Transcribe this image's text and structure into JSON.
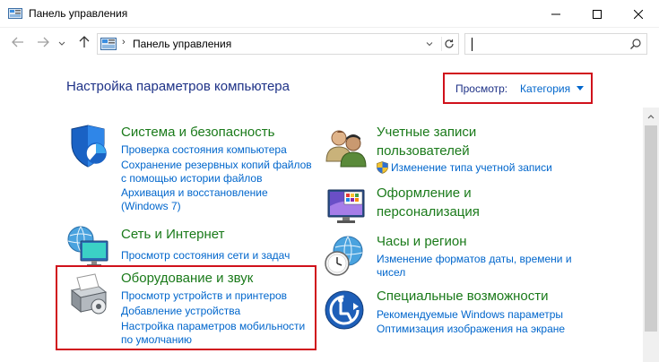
{
  "window": {
    "title": "Панель управления",
    "minimize_icon": "minimize-icon",
    "maximize_icon": "maximize-icon",
    "close_icon": "close-icon"
  },
  "address_bar": {
    "separator": "›",
    "path": "Панель управления",
    "search_placeholder": ""
  },
  "header": {
    "title": "Настройка параметров компьютера",
    "view_label": "Просмотр:",
    "view_value": "Категория"
  },
  "categories": {
    "system": {
      "title": "Система и безопасность",
      "links": [
        "Проверка состояния компьютера",
        "Сохранение резервных копий файлов",
        "с помощью истории файлов",
        "Архивация и восстановление",
        "(Windows 7)"
      ]
    },
    "network": {
      "title": "Сеть и Интернет",
      "links": [
        "Просмотр состояния сети и задач"
      ]
    },
    "hardware": {
      "title": "Оборудование и звук",
      "links": [
        "Просмотр устройств и принтеров",
        "Добавление устройства",
        "Настройка параметров мобильности",
        "по умолчанию"
      ]
    },
    "accounts": {
      "title_line1": "Учетные записи",
      "title_line2": "пользователей",
      "links": [
        "Изменение типа учетной записи"
      ]
    },
    "appearance": {
      "title_line1": "Оформление и",
      "title_line2": "персонализация"
    },
    "clock": {
      "title": "Часы и регион",
      "links": [
        "Изменение форматов даты, времени и",
        "чисел"
      ]
    },
    "ease": {
      "title": "Специальные возможности",
      "links": [
        "Рекомендуемые Windows параметры",
        "Оптимизация изображения на экране"
      ]
    }
  },
  "colors": {
    "category_title": "#1a7a1a",
    "link": "#0066cc",
    "heading": "#1e3287",
    "highlight": "#d0111b"
  }
}
